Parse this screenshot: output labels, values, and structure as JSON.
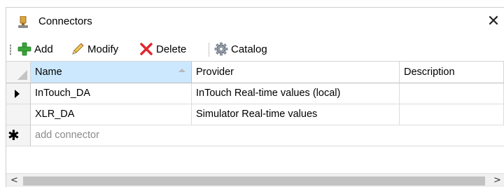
{
  "window": {
    "title": "Connectors",
    "close_glyph": "✕"
  },
  "toolbar": {
    "add_label": "Add",
    "modify_label": "Modify",
    "delete_label": "Delete",
    "catalog_label": "Catalog"
  },
  "grid": {
    "columns": [
      "Name",
      "Provider",
      "Description"
    ],
    "rows": [
      {
        "name": "InTouch_DA",
        "provider": "InTouch Real-time values (local)",
        "description": "",
        "current": true
      },
      {
        "name": "XLR_DA",
        "provider": "Simulator Real-time values",
        "description": "",
        "current": false
      }
    ],
    "new_row_placeholder": "add connector"
  },
  "scrollbar": {
    "left_arrow": "<",
    "right_arrow": ">"
  },
  "colors": {
    "header_selected": "#cce8ff",
    "add_green": "#3aa53a",
    "delete_red": "#e0282e",
    "scroll_thumb": "#c2c2c2"
  },
  "icons": {
    "title": "connector-plug-icon",
    "add": "plus-icon",
    "modify": "pencil-icon",
    "delete": "x-icon",
    "catalog": "gear-icon"
  }
}
